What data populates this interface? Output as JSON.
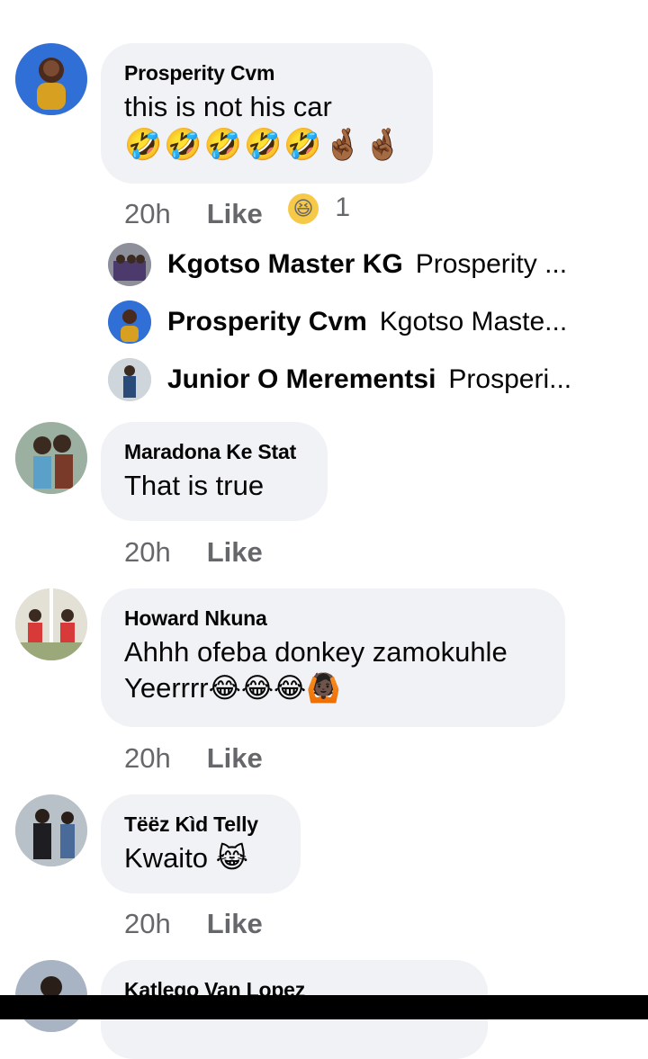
{
  "comments": [
    {
      "author": "Prosperity Cvm",
      "text": "this is not his car",
      "emojis": "🤣🤣🤣🤣🤣🤞🏾🤞🏾",
      "time": "20h",
      "like": "Like",
      "reaction_count": "1"
    },
    {
      "author": "Maradona Ke Stat",
      "text": "That is true",
      "time": "20h",
      "like": "Like"
    },
    {
      "author": "Howard Nkuna",
      "text": "Ahhh ofeba donkey zamokuhle",
      "text2": "Yeerrrr😂😂😂🙆🏿",
      "time": "20h",
      "like": "Like"
    },
    {
      "author": "Tëëz Kìd Telly",
      "text": "Kwaito 😹",
      "time": "20h",
      "like": "Like"
    },
    {
      "author": "Katlego Van Lopez"
    }
  ],
  "replies": [
    {
      "name": "Kgotso Master KG",
      "text": "Prosperity ..."
    },
    {
      "name": "Prosperity Cvm",
      "text": "Kgotso Maste..."
    },
    {
      "name": "Junior O Merementsi",
      "text": "Prosperi..."
    }
  ],
  "colors": {
    "bubble": "#f0f2f5",
    "meta": "#65676b",
    "text": "#050505"
  },
  "icons": {
    "reaction": "laughing-face-icon"
  }
}
